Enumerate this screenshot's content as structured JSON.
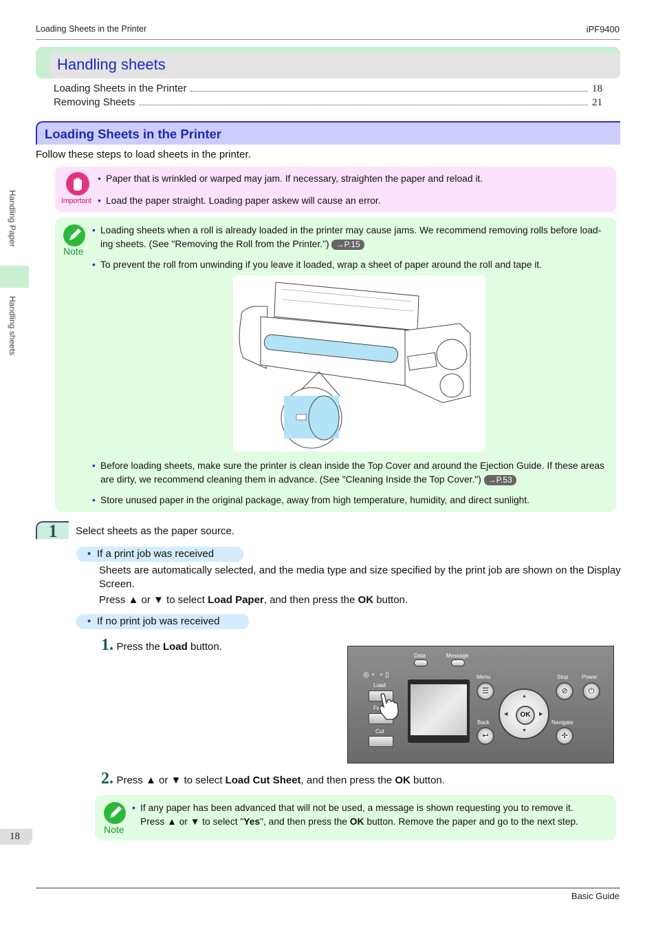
{
  "header": {
    "left": "Loading Sheets in the Printer",
    "right": "iPF9400"
  },
  "chapter": {
    "title": "Handling sheets",
    "toc": [
      {
        "label": "Loading Sheets in the Printer",
        "page": "18"
      },
      {
        "label": "Removing Sheets",
        "page": "21"
      }
    ]
  },
  "section": {
    "title": "Loading Sheets in the Printer",
    "intro": "Follow these steps to load sheets in the printer."
  },
  "important": {
    "label": "Important",
    "icon": "hand-stop-icon",
    "items": [
      "Paper that is wrinkled or warped may jam. If necessary, straighten the paper and reload it.",
      "Load the paper straight. Loading paper askew will cause an error."
    ]
  },
  "note1": {
    "label": "Note",
    "icon": "pencil-icon",
    "items": [
      {
        "text": "Loading sheets when a roll is already loaded in the printer may cause jams. We recommend removing rolls before load-ing sheets.  (See \"Removing the Roll from the Printer.\")",
        "ref": "→P.15"
      },
      {
        "text": "To prevent the roll from unwinding if you leave it loaded, wrap a sheet of paper around the roll and tape it."
      },
      {
        "text": "Before loading sheets, make sure the printer is clean inside the Top Cover and around the Ejection Guide. If these areas are dirty, we recommend cleaning them in advance.  (See \"Cleaning Inside the Top Cover.\")",
        "ref": "→P.53"
      },
      {
        "text": "Store unused paper in the original package, away from high temperature, humidity, and direct sunlight."
      }
    ]
  },
  "step1": {
    "number": "1",
    "text": "Select sheets as the paper source.",
    "case_a": {
      "label": "If a print job was received",
      "para1": "Sheets are automatically selected, and the media type and size specified by the print job are shown on the Display Screen.",
      "para2_pre": "Press ▲ or ▼ to select ",
      "para2_bold1": "Load Paper",
      "para2_mid": ", and then press the ",
      "para2_bold2": "OK",
      "para2_post": " button."
    },
    "case_b": {
      "label": "If no print job was received",
      "sub1": {
        "num": "1.",
        "pre": "Press the ",
        "bold": "Load",
        "post": " button."
      },
      "sub2": {
        "num": "2.",
        "pre": "Press ▲ or ▼ to select ",
        "bold1": "Load Cut Sheet",
        "mid": ", and then press the ",
        "bold2": "OK",
        "post": " button."
      }
    }
  },
  "control_panel": {
    "labels": {
      "data": "Data",
      "message": "Message",
      "load": "Load",
      "feed": "Feed",
      "cut": "Cut",
      "menu": "Menu",
      "back": "Back",
      "stop": "Stop",
      "power": "Power",
      "navigate": "Navigate",
      "ok": "OK"
    }
  },
  "note2": {
    "label": "Note",
    "line1": "If any paper has been advanced that will not be used, a message is shown requesting you to remove it.",
    "line2_pre": "Press ▲ or ▼ to select \"",
    "line2_bold1": "Yes",
    "line2_mid": "\", and then press the ",
    "line2_bold2": "OK",
    "line2_post": " button. Remove the paper and go to the next step."
  },
  "sidebar": {
    "tab1": "Handling Paper",
    "tab2": "Handling sheets",
    "page_number": "18"
  },
  "footer": {
    "right": "Basic Guide"
  }
}
